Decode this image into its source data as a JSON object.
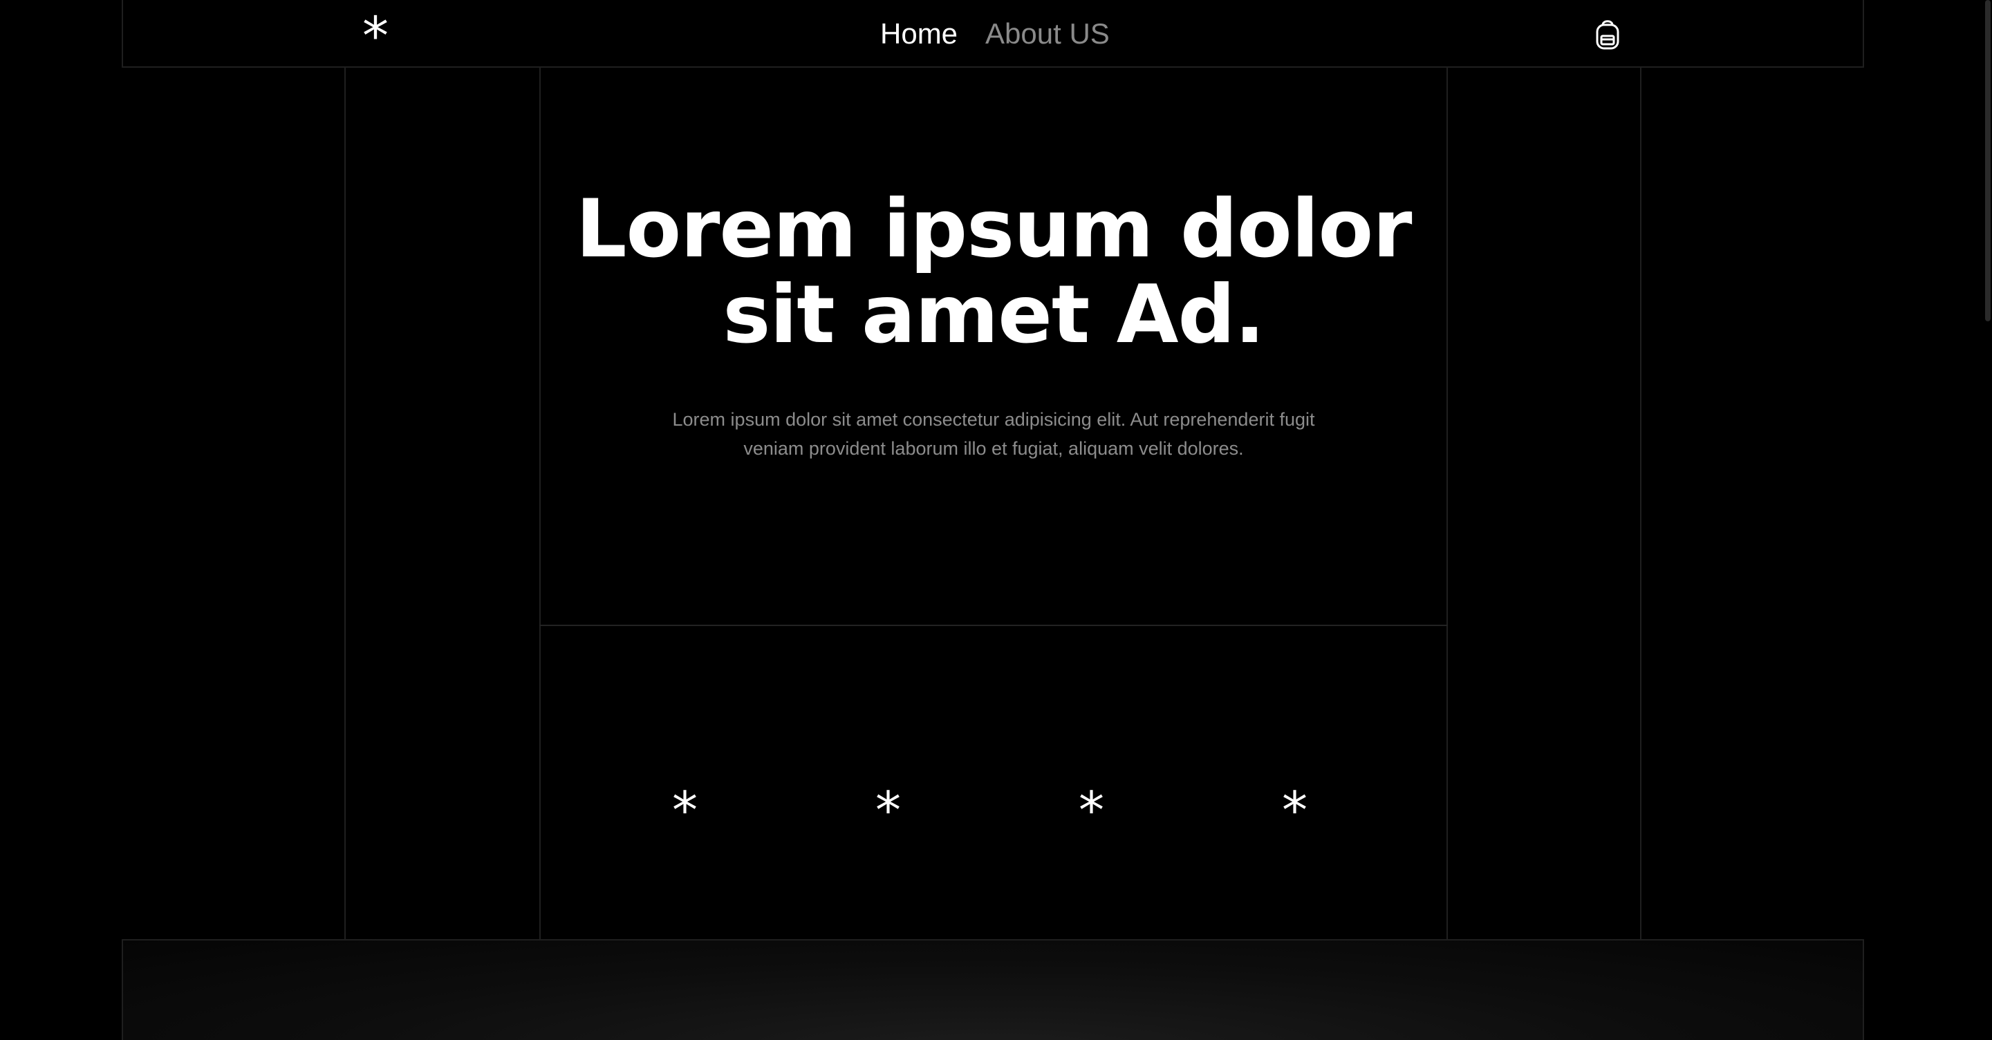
{
  "nav": {
    "logo": "*",
    "links": [
      {
        "label": "Home",
        "active": true
      },
      {
        "label": "About US",
        "active": false
      }
    ],
    "cart_icon": "shopping-bag-icon"
  },
  "hero": {
    "title": "Lorem ipsum dolor sit amet Ad.",
    "subtitle": "Lorem ipsum dolor sit amet consectetur adipisicing elit. Aut reprehenderit fugit veniam provident laborum illo et fugiat, aliquam velit dolores."
  },
  "stars": [
    "*",
    "*",
    "*",
    "*"
  ],
  "colors": {
    "background": "#000000",
    "text": "#ffffff",
    "muted_text": "#8c8c8c",
    "grid_line": "#1f1f1f"
  }
}
